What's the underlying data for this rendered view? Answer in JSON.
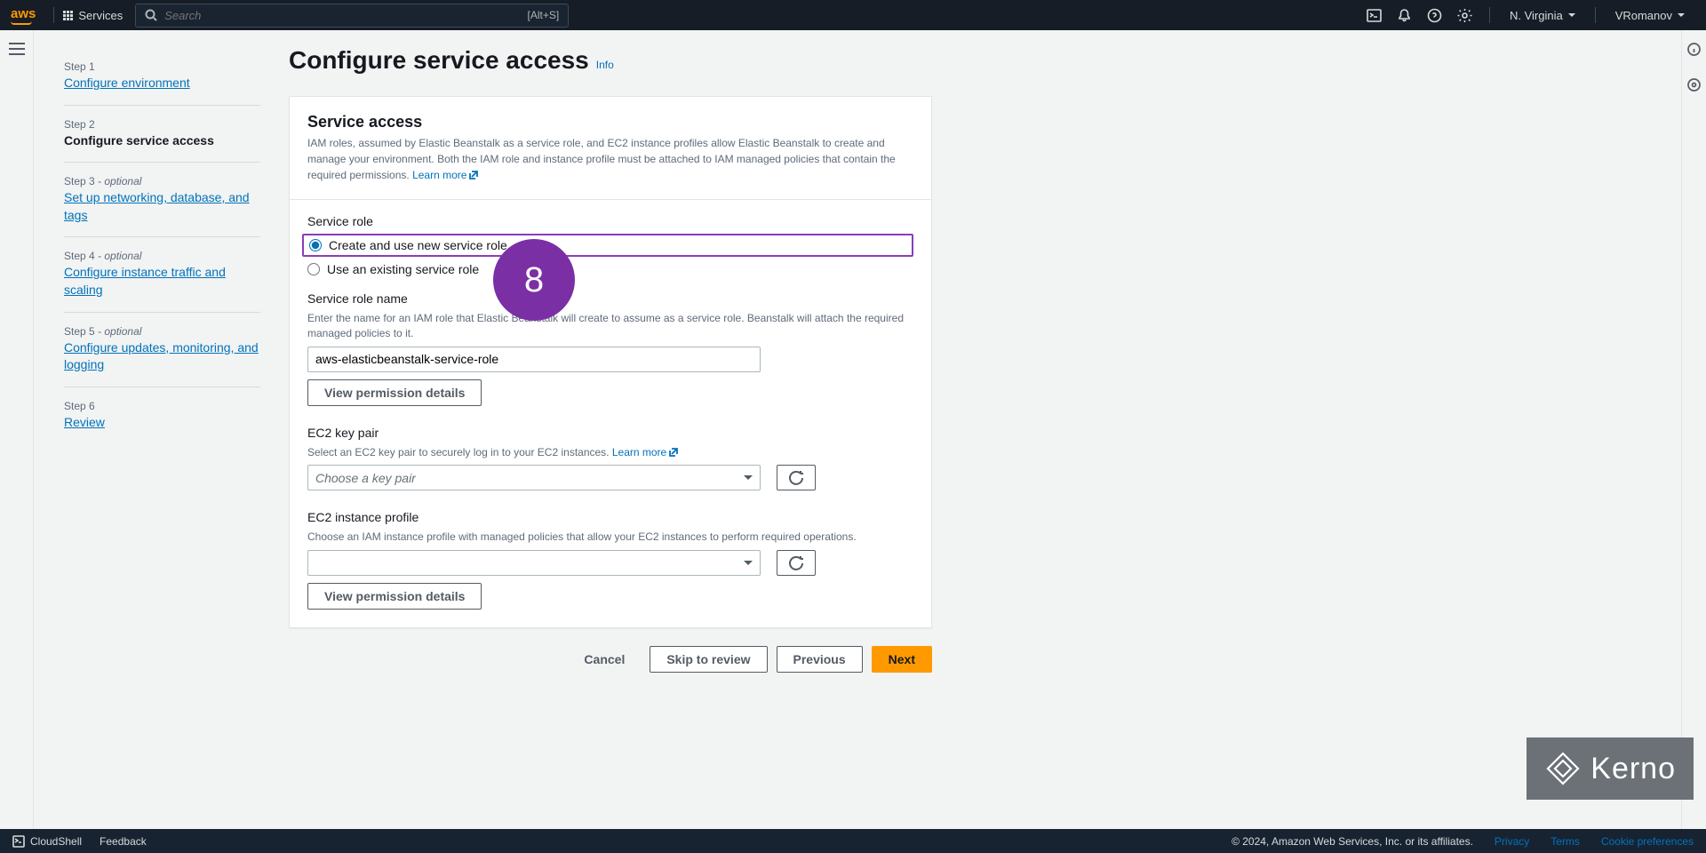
{
  "topnav": {
    "logo": "aws",
    "services": "Services",
    "search_placeholder": "Search",
    "search_shortcut": "[Alt+S]",
    "region": "N. Virginia",
    "user": "VRomanov"
  },
  "sidebar": {
    "steps": [
      {
        "line1": "Step 1",
        "title": "Configure environment",
        "link": true
      },
      {
        "line1": "Step 2",
        "title": "Configure service access",
        "current": true
      },
      {
        "line1": "Step 3",
        "optional": "- optional",
        "title": "Set up networking, database, and tags",
        "link": true
      },
      {
        "line1": "Step 4",
        "optional": "- optional",
        "title": "Configure instance traffic and scaling",
        "link": true
      },
      {
        "line1": "Step 5",
        "optional": "- optional",
        "title": "Configure updates, monitoring, and logging",
        "link": true
      },
      {
        "line1": "Step 6",
        "title": "Review",
        "link": true
      }
    ]
  },
  "page": {
    "title": "Configure service access",
    "info": "Info"
  },
  "panel": {
    "heading": "Service access",
    "desc": "IAM roles, assumed by Elastic Beanstalk as a service role, and EC2 instance profiles allow Elastic Beanstalk to create and manage your environment. Both the IAM role and instance profile must be attached to IAM managed policies that contain the required permissions.",
    "learn_more": "Learn more"
  },
  "service_role": {
    "label": "Service role",
    "opt_create": "Create and use new service role",
    "opt_existing": "Use an existing service role",
    "name_label": "Service role name",
    "name_desc": "Enter the name for an IAM role that Elastic Beanstalk will create to assume as a service role. Beanstalk will attach the required managed policies to it.",
    "name_value": "aws-elasticbeanstalk-service-role",
    "view_btn": "View permission details"
  },
  "keypair": {
    "label": "EC2 key pair",
    "desc": "Select an EC2 key pair to securely log in to your EC2 instances.",
    "learn_more": "Learn more",
    "placeholder": "Choose a key pair"
  },
  "instance_profile": {
    "label": "EC2 instance profile",
    "desc": "Choose an IAM instance profile with managed policies that allow your EC2 instances to perform required operations.",
    "view_btn": "View permission details"
  },
  "actions": {
    "cancel": "Cancel",
    "skip": "Skip to review",
    "previous": "Previous",
    "next": "Next"
  },
  "footer": {
    "cloudshell": "CloudShell",
    "feedback": "Feedback",
    "copyright": "© 2024, Amazon Web Services, Inc. or its affiliates.",
    "privacy": "Privacy",
    "terms": "Terms",
    "cookies": "Cookie preferences"
  },
  "overlay": {
    "badge_number": "8",
    "brand": "Kerno"
  }
}
